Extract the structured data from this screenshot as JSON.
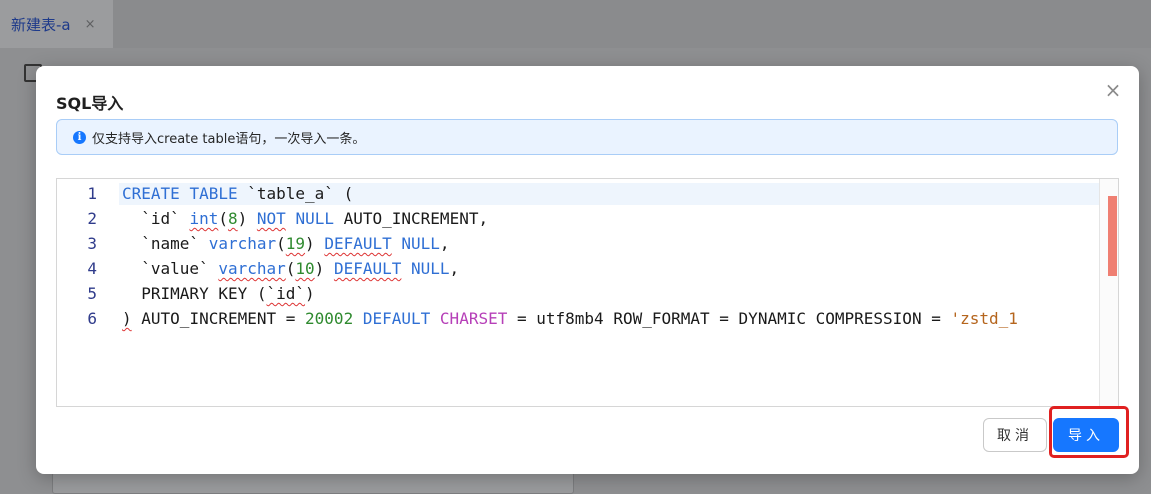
{
  "background": {
    "tab_label": "新建表-a",
    "tab_close": "×"
  },
  "modal": {
    "title": "SQL导入",
    "close_symbol": "×",
    "alert": {
      "icon": "info-icon",
      "text": "仅支持导入create table语句，一次导入一条。"
    },
    "editor": {
      "line_numbers": [
        "1",
        "2",
        "3",
        "4",
        "5",
        "6"
      ],
      "lines": [
        "CREATE TABLE `table_a` (",
        "  `id` int(8) NOT NULL AUTO_INCREMENT,",
        "  `name` varchar(19) DEFAULT NULL,",
        "  `value` varchar(10) DEFAULT NULL,",
        "  PRIMARY KEY (`id`)",
        ") AUTO_INCREMENT = 20002 DEFAULT CHARSET = utf8mb4 ROW_FORMAT = DYNAMIC COMPRESSION = 'zstd_1"
      ]
    },
    "buttons": {
      "cancel": "取消",
      "import": "导入"
    },
    "colors": {
      "keyword": "#2f6fd4",
      "number": "#2f8a2f",
      "charset": "#b63fb8",
      "primary": "#1677ff",
      "highlight": "#e02020"
    }
  }
}
